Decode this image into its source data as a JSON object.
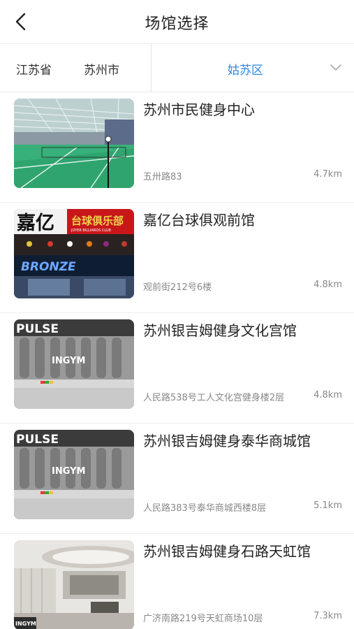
{
  "header": {
    "title": "场馆选择",
    "back_icon": "chevron-left-icon"
  },
  "region": {
    "province": "江苏省",
    "city": "苏州市",
    "district": "姑苏区",
    "expand_icon": "chevron-down-icon",
    "active_color": "#2b8ae6"
  },
  "venues": [
    {
      "name": "苏州市民健身中心",
      "address": "五卅路83",
      "distance": "4.7km",
      "image": "badminton-court-photo"
    },
    {
      "name": "嘉亿台球俱观前馆",
      "address": "观前街212号6楼",
      "distance": "4.8km",
      "image": "billiards-club-storefront-photo",
      "image_text": {
        "brand": "嘉亿",
        "sign": "台球俱乐部",
        "sub": "JOYER BILLIARDS CLUB",
        "neon": "BRONZE"
      }
    },
    {
      "name": "苏州银吉姆健身文化宫馆",
      "address": "人民路538号工人文化宫健身楼2层",
      "distance": "4.8km",
      "image": "gym-interior-photo",
      "image_text": {
        "brand": "PULSE",
        "wall": "INGYM"
      }
    },
    {
      "name": "苏州银吉姆健身泰华商城馆",
      "address": "人民路383号泰华商城西楼8层",
      "distance": "5.1km",
      "image": "gym-interior-photo",
      "image_text": {
        "brand": "PULSE",
        "wall": "INGYM"
      }
    },
    {
      "name": "苏州银吉姆健身石路天虹馆",
      "address": "广济南路219号天虹商场10层",
      "distance": "7.3km",
      "image": "gym-lobby-photo",
      "image_text": {
        "wall": "INGYM"
      }
    }
  ]
}
